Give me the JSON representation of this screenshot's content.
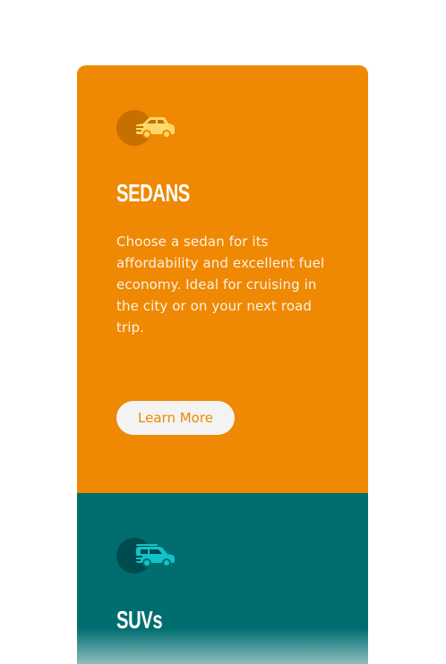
{
  "cards": [
    {
      "id": "sedans",
      "icon": "sedan-car-icon",
      "title": "SEDANS",
      "description": "Choose a sedan for its affordability and excellent fuel economy. Ideal for cruising in the city or on your next road trip.",
      "button_label": "Learn More",
      "colors": {
        "background": "#EF8802",
        "icon_circle": "#C76F00",
        "icon_car": "#FFD86B",
        "button_bg": "#F3F3F3",
        "button_text": "#EF8802"
      }
    },
    {
      "id": "suvs",
      "icon": "suv-car-icon",
      "title": "SUVs",
      "colors": {
        "background": "#006D70",
        "icon_circle": "#004B4D",
        "icon_car": "#10C3C8"
      }
    }
  ]
}
